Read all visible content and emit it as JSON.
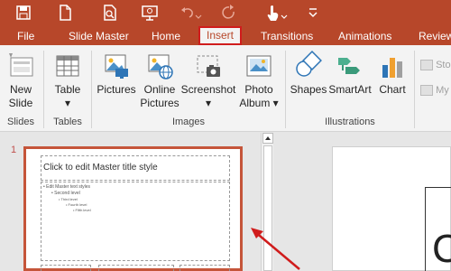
{
  "tabs": {
    "file": "File",
    "slide_master": "Slide Master",
    "home": "Home",
    "insert": "Insert",
    "transitions": "Transitions",
    "animations": "Animations",
    "review": "Review"
  },
  "ribbon": {
    "new_slide": [
      "New",
      "Slide"
    ],
    "table": "Table",
    "pictures": "Pictures",
    "online_pictures": [
      "Online",
      "Pictures"
    ],
    "screenshot": "Screenshot",
    "photo_album": [
      "Photo",
      "Album"
    ],
    "shapes": "Shapes",
    "smartart": "SmartArt",
    "chart": "Chart",
    "store": "Sto",
    "my": "My",
    "groups": {
      "slides": "Slides",
      "tables": "Tables",
      "images": "Images",
      "illustrations": "Illustrations"
    }
  },
  "thumbnail": {
    "number": "1",
    "title": "Click to edit Master title style",
    "lines": [
      "• Edit Master text styles",
      "• Second level",
      "• Third level",
      "• Fourth level",
      "• Fifth level"
    ]
  },
  "canvas": {
    "glyph": "C"
  },
  "colors": {
    "accent": "#b7472a",
    "highlight_border": "#d01c1c",
    "arrow": "#d01c1c"
  }
}
